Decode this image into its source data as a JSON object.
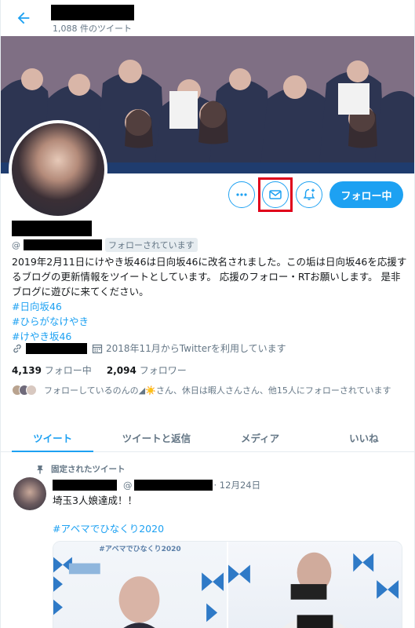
{
  "header": {
    "tweet_count": "1,088 件のツイート"
  },
  "actions": {
    "follow_label": "フォロー中"
  },
  "profile": {
    "handle_prefix": "@",
    "follows_you": "フォローされています",
    "bio": "2019年2月11日にけやき坂46は日向坂46に改名されました。この垢は日向坂46を応援するブログの更新情報をツイートとしています。 応援のフォロー・RTお願いします。 是非ブログに遊びに来てください。",
    "hashtags": [
      "#日向坂46",
      "#ひらがなけやき",
      "#けやき坂46"
    ],
    "joined": "2018年11月からTwitterを利用しています",
    "following_count": "4,139",
    "following_label": "フォロー中",
    "followers_count": "2,094",
    "followers_label": "フォロワー",
    "known_followers": "フォローしているのんの◢☀️さん、休日は暇人さんさん、他15人にフォローされています"
  },
  "tabs": [
    {
      "label": "ツイート"
    },
    {
      "label": "ツイートと返信"
    },
    {
      "label": "メディア"
    },
    {
      "label": "いいね"
    }
  ],
  "pinned_tweet": {
    "pinned_label": "固定されたツイート",
    "handle_prefix": "@",
    "date": "· 12月24日",
    "text": "埼玉3人娘達成！！",
    "hashtag": "#アベマでひなくり2020",
    "media_caption": "#アベマでひなくり2020"
  },
  "colors": {
    "accent": "#1da1f2",
    "highlight": "#e0001a"
  }
}
